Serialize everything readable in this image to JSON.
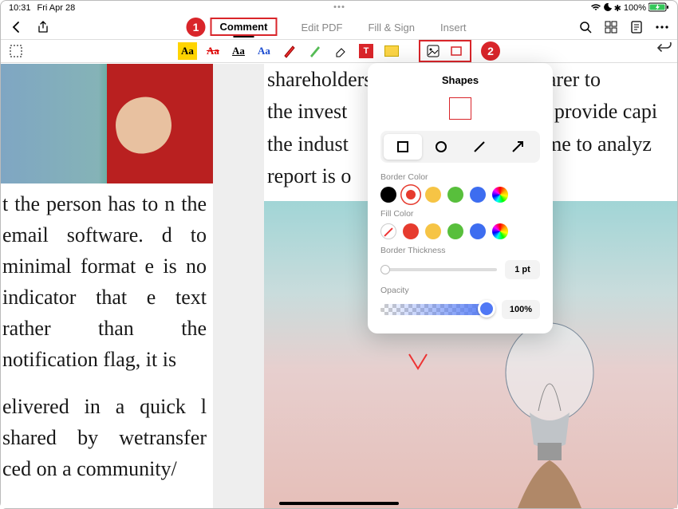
{
  "status": {
    "time": "10:31",
    "date": "Fri Apr 28",
    "battery": "100%"
  },
  "tabs": {
    "comment": "Comment",
    "edit": "Edit PDF",
    "fillsign": "Fill & Sign",
    "insert": "Insert"
  },
  "callouts": {
    "one": "1",
    "two": "2"
  },
  "shapes_panel": {
    "title": "Shapes",
    "border_color_label": "Border Color",
    "fill_color_label": "Fill Color",
    "border_thickness_label": "Border Thickness",
    "opacity_label": "Opacity",
    "thickness_value": "1 pt",
    "opacity_value": "100%",
    "border_colors": [
      "#000000",
      "#e63b2e",
      "#f6c445",
      "#58bf3c",
      "#3d6df0",
      "rainbow"
    ],
    "fill_colors": [
      "none",
      "#e63b2e",
      "#f6c445",
      "#58bf3c",
      "#3d6df0",
      "rainbow"
    ]
  },
  "document": {
    "left_p1": "t the person has to n the email software. d to minimal format e is no indicator that e text rather than the notification flag, it is",
    "left_p2": "elivered in a quick l shared by wetransfer ced on a community/",
    "right_l1": "shareholders. Since the data is clearer to",
    "right_l2": "the invest",
    "right_l2b": "o provide capi",
    "right_l3": "the indust",
    "right_l3b": "ime to analyz",
    "right_l4": "report is o"
  }
}
